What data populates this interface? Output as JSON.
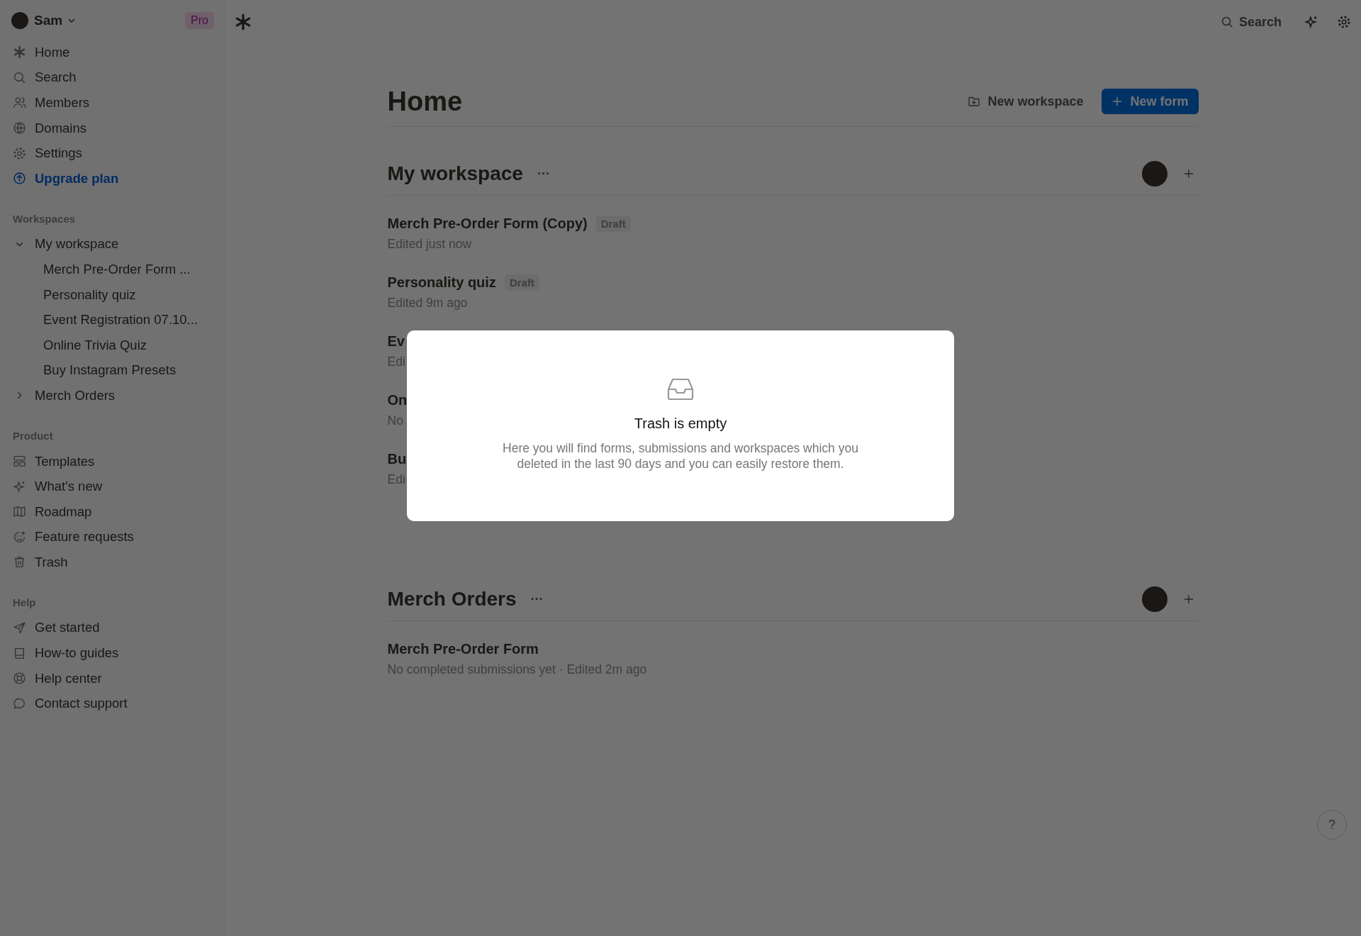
{
  "account": {
    "name": "Sam",
    "plan": "Pro"
  },
  "nav": [
    {
      "label": "Home",
      "kind": "link"
    },
    {
      "label": "Search",
      "kind": "link"
    },
    {
      "label": "Members",
      "kind": "link"
    },
    {
      "label": "Domains",
      "kind": "link"
    },
    {
      "label": "Settings",
      "kind": "link"
    },
    {
      "label": "Upgrade plan",
      "kind": "upgrade"
    }
  ],
  "workspaces_heading": "Workspaces",
  "workspaces_tree": [
    {
      "label": "My workspace",
      "expanded": true,
      "children": [
        {
          "label": "Merch Pre-Order Form ..."
        },
        {
          "label": "Personality quiz"
        },
        {
          "label": "Event Registration 07.10..."
        },
        {
          "label": "Online Trivia Quiz"
        },
        {
          "label": "Buy Instagram Presets"
        }
      ]
    },
    {
      "label": "Merch Orders",
      "expanded": false
    }
  ],
  "product_heading": "Product",
  "product": [
    {
      "label": "Templates"
    },
    {
      "label": "What's new"
    },
    {
      "label": "Roadmap"
    },
    {
      "label": "Feature requests"
    },
    {
      "label": "Trash"
    }
  ],
  "help_heading": "Help",
  "help": [
    {
      "label": "Get started"
    },
    {
      "label": "How-to guides"
    },
    {
      "label": "Help center"
    },
    {
      "label": "Contact support"
    }
  ],
  "topbar": {
    "search_label": "Search"
  },
  "page": {
    "title": "Home",
    "buttons": [
      {
        "label": "New workspace",
        "kind": "secondary"
      },
      {
        "label": "New form",
        "kind": "primary"
      }
    ]
  },
  "sections": [
    {
      "name": "My workspace",
      "more": "···",
      "forms": [
        {
          "title": "Merch Pre-Order Form (Copy)",
          "badge": "Draft",
          "meta": "Edited just now"
        },
        {
          "title": "Personality quiz",
          "badge": "Draft",
          "meta": "Edited 9m ago"
        },
        {
          "title": "Ev",
          "meta": "Edi"
        },
        {
          "title": "On",
          "meta": "No"
        },
        {
          "title": "Bu",
          "meta": "Edi"
        }
      ]
    },
    {
      "name": "Merch Orders",
      "more": "···",
      "forms": [
        {
          "title": "Merch Pre-Order Form",
          "meta": "No completed submissions yet · Edited 2m ago"
        }
      ]
    }
  ],
  "modal": {
    "title": "Trash is empty",
    "text": "Here you will find forms, submissions and workspaces which you deleted in the last 90 days and you can easily restore them."
  },
  "help_button": "?"
}
